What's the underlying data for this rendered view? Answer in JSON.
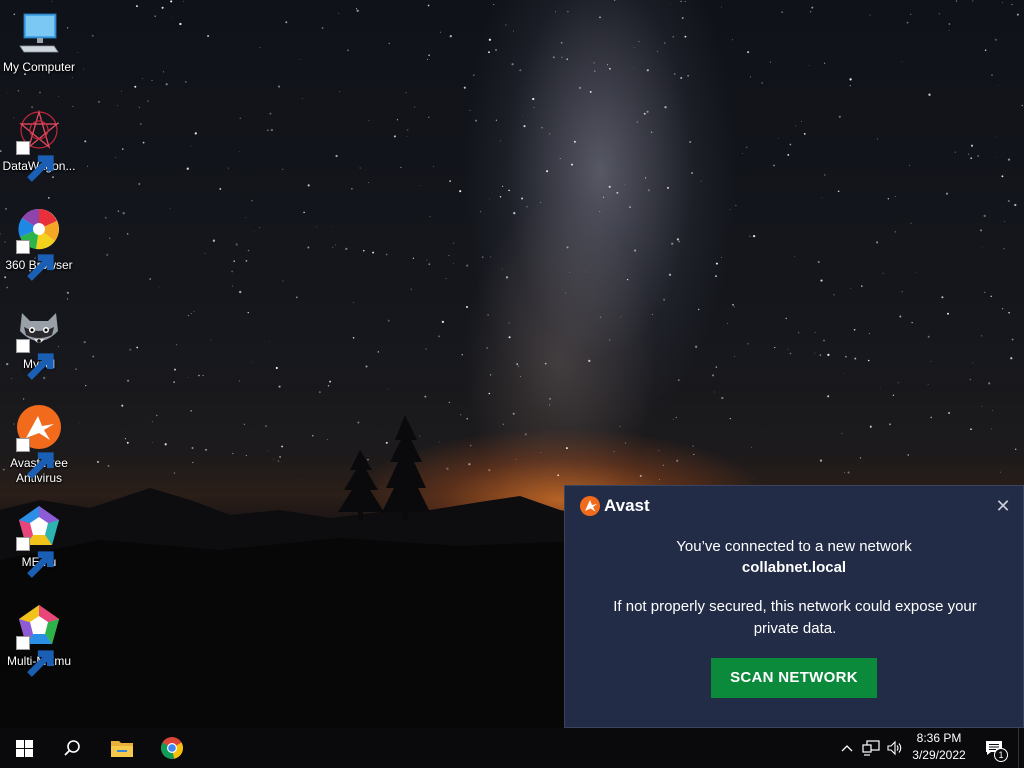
{
  "desktop": {
    "icons": [
      {
        "label": "My Computer",
        "icon": "computer-icon"
      },
      {
        "label": "DataWagon...",
        "icon": "datawagon-icon"
      },
      {
        "label": "360 Browser",
        "icon": "360-browser-icon"
      },
      {
        "label": "Mypal",
        "icon": "mypal-raccoon-icon"
      },
      {
        "label": "Avast Free Antivirus",
        "icon": "avast-icon"
      },
      {
        "label": "MEmu",
        "icon": "memu-icon"
      },
      {
        "label": "Multi-MEmu",
        "icon": "multi-memu-icon"
      }
    ]
  },
  "avast_popup": {
    "brand": "Avast",
    "line1": "You’ve connected to a new network",
    "network_name": "collabnet.local",
    "message": "If not properly secured, this network could expose your private data.",
    "button_label": "SCAN NETWORK",
    "close_label": "✕",
    "button_color": "#0c8a3c",
    "background_color": "#222c47",
    "logo_color": "#f26b1d"
  },
  "taskbar": {
    "start": "windows-start-icon",
    "search": "search-icon",
    "pinned": [
      "file-explorer-icon",
      "chrome-icon"
    ],
    "tray": [
      "chevron-up-icon",
      "network-icon",
      "volume-icon"
    ],
    "time": "8:36 PM",
    "date": "3/29/2022",
    "notification_count": "1"
  }
}
